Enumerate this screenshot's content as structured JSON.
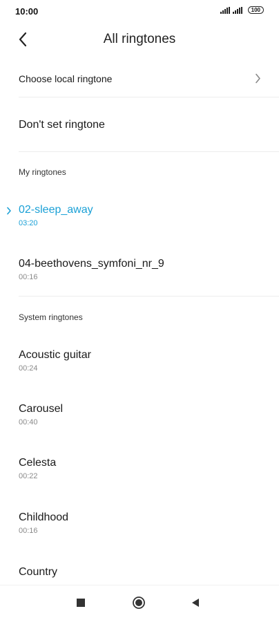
{
  "status_bar": {
    "time": "10:00",
    "battery": "100"
  },
  "header": {
    "title": "All ringtones"
  },
  "local": {
    "label": "Choose local ringtone"
  },
  "none": {
    "label": "Don't set ringtone"
  },
  "my_ringtones": {
    "header": "My ringtones",
    "items": [
      {
        "name": "02-sleep_away",
        "duration": "03:20",
        "selected": true
      },
      {
        "name": "04-beethovens_symfoni_nr_9",
        "duration": "00:16"
      }
    ]
  },
  "system_ringtones": {
    "header": "System ringtones",
    "items": [
      {
        "name": "Acoustic guitar",
        "duration": "00:24"
      },
      {
        "name": "Carousel",
        "duration": "00:40"
      },
      {
        "name": "Celesta",
        "duration": "00:22"
      },
      {
        "name": "Childhood",
        "duration": "00:16"
      },
      {
        "name": "Country",
        "duration": ""
      }
    ]
  },
  "colors": {
    "accent": "#1aa0d6"
  },
  "nav_icons": [
    "recents-square-icon",
    "home-circle-icon",
    "back-triangle-icon"
  ]
}
